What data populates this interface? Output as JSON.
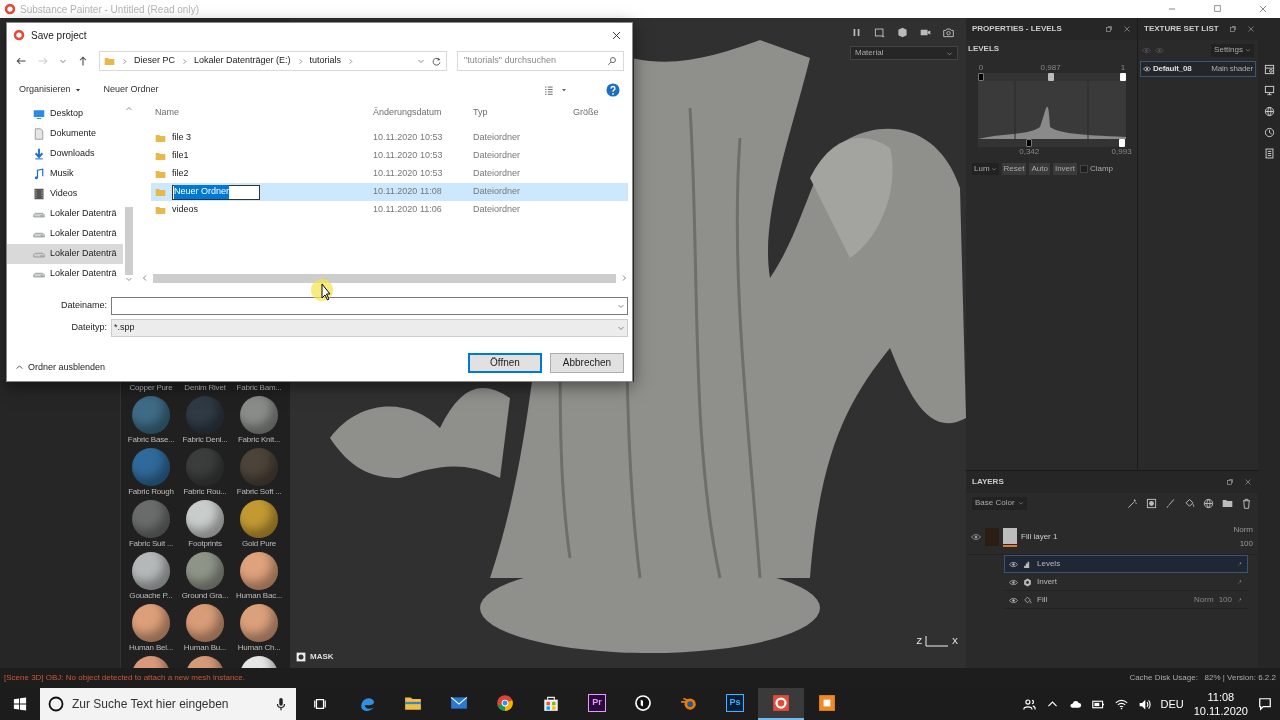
{
  "app_title": "Substance Painter - Untitled (Read only)",
  "dialog": {
    "title": "Save project",
    "breadcrumb": [
      "Dieser PC",
      "Lokaler Datenträger (E:)",
      "tutorials"
    ],
    "search": {
      "placeholder": "\"tutorials\" durchsuchen"
    },
    "toolbar": [
      {
        "label": "Organisieren",
        "menu": true
      },
      {
        "label": "Neuer Ordner",
        "menu": false
      }
    ],
    "sidebar": [
      {
        "kind": "desktop",
        "label": "Desktop",
        "selected": false
      },
      {
        "kind": "documents",
        "label": "Dokumente",
        "selected": false
      },
      {
        "kind": "downloads",
        "label": "Downloads",
        "selected": false
      },
      {
        "kind": "music",
        "label": "Musik",
        "selected": false
      },
      {
        "kind": "videos",
        "label": "Videos",
        "selected": false
      },
      {
        "kind": "drive",
        "label": "Lokaler Datenträ",
        "selected": false
      },
      {
        "kind": "drive",
        "label": "Lokaler Datenträ",
        "selected": false
      },
      {
        "kind": "drive",
        "label": "Lokaler Datenträ",
        "selected": true
      },
      {
        "kind": "drive",
        "label": "Lokaler Datenträ",
        "selected": false
      }
    ],
    "columns": [
      "Name",
      "Änderungsdatum",
      "Typ",
      "Größe"
    ],
    "files": [
      {
        "name": "file 3",
        "modified": "10.11.2020 10:53",
        "type": "Dateiordner",
        "selected": false,
        "editing": false
      },
      {
        "name": "file1",
        "modified": "10.11.2020 10:53",
        "type": "Dateiordner",
        "selected": false,
        "editing": false
      },
      {
        "name": "file2",
        "modified": "10.11.2020 10:53",
        "type": "Dateiordner",
        "selected": false,
        "editing": false
      },
      {
        "name": "Neuer Ordner",
        "modified": "10.11.2020 11:08",
        "type": "Dateiordner",
        "selected": true,
        "editing": true
      },
      {
        "name": "videos",
        "modified": "10.11.2020 11:06",
        "type": "Dateiordner",
        "selected": false,
        "editing": false
      }
    ],
    "fields": [
      {
        "kind": "combo",
        "label": "Dateiname:"
      },
      {
        "kind": "select",
        "label": "Dateityp:",
        "value": "*.spp"
      }
    ],
    "hide_folders": "Ordner ausblenden",
    "buttons": [
      {
        "label": "Öffnen",
        "default": true
      },
      {
        "label": "Abbrechen",
        "default": false
      }
    ]
  },
  "viewport": {
    "channel_dropdown": "Material",
    "mask_label": "MASK",
    "axes": [
      "Z",
      "X"
    ]
  },
  "properties": {
    "title": "PROPERTIES - LEVELS",
    "section": "LEVELS",
    "input_handles": [
      {
        "reading": "0",
        "level": 0
      },
      {
        "reading": "0,987",
        "level": 0.49
      },
      {
        "reading": "1",
        "level": 1
      }
    ],
    "output_handles": [
      {
        "reading": "0,342",
        "level": 0.34
      },
      {
        "reading": "0,993",
        "level": 0.99
      }
    ],
    "channel": "Lum",
    "buttons": [
      "Reset",
      "Auto",
      "Invert"
    ],
    "clamp": {
      "label": "Clamp",
      "checked": false
    }
  },
  "texture_set_list": {
    "title": "TEXTURE SET LIST",
    "settings": "Settings",
    "sets": [
      {
        "name": "Default_08",
        "shader": "Main shader",
        "selected": true,
        "visible": true
      }
    ]
  },
  "layers": {
    "title": "LAYERS",
    "channel": "Base Color",
    "items": [
      {
        "name": "Fill layer 1",
        "blend": "Norm",
        "opacity": "100",
        "visible": true,
        "selected": false,
        "children": [
          {
            "kind": "levels",
            "name": "Levels",
            "selected": true,
            "visible": true
          },
          {
            "kind": "invert",
            "name": "Invert",
            "selected": false,
            "visible": true
          },
          {
            "kind": "fill",
            "name": "Fill",
            "blend": "Norm",
            "opacity": "100",
            "selected": false,
            "visible": true
          }
        ]
      }
    ]
  },
  "shelf": {
    "header_labels": [
      "Copper Pure",
      "Denim Rivet",
      "Fabric Bam..."
    ],
    "materials": [
      {
        "label": "Fabric Base...",
        "color": "#3e6b86"
      },
      {
        "label": "Fabric Deni...",
        "color": "#2f3a44"
      },
      {
        "label": "Fabric Knit...",
        "color": "#8a8c8a"
      },
      {
        "label": "Fabric Rough",
        "color": "#2f6a9a"
      },
      {
        "label": "Fabric Rou...",
        "color": "#3b3c3c"
      },
      {
        "label": "Fabric Soft ...",
        "color": "#4c4339"
      },
      {
        "label": "Fabric Suit ...",
        "color": "#6a6c6c"
      },
      {
        "label": "Footprints",
        "color": "#c8cccb"
      },
      {
        "label": "Gold Pure",
        "color": "#c39a32"
      },
      {
        "label": "Gouache P...",
        "color": "#b4b8b8"
      },
      {
        "label": "Ground Gra...",
        "color": "#8e9488"
      },
      {
        "label": "Human Bac...",
        "color": "#dea27c"
      },
      {
        "label": "Human Bel...",
        "color": "#dc9f7a"
      },
      {
        "label": "Human Bu...",
        "color": "#d99c78"
      },
      {
        "label": "Human Ch...",
        "color": "#dba07c"
      }
    ],
    "partial_row": [
      {
        "color": "#d9997a"
      },
      {
        "color": "#d69a78"
      },
      {
        "color": "#e6e6e6"
      }
    ]
  },
  "status_bar": {
    "message": "[Scene 3D] OBJ: No object detected to attach a new mesh instance.",
    "info": "Cache Disk Usage:   82% | Version: 6.2.2"
  },
  "taskbar": {
    "search_placeholder": "Zur Suche Text hier eingeben",
    "apps": [
      {
        "kind": "edge",
        "active": false
      },
      {
        "kind": "explorer",
        "active": false
      },
      {
        "kind": "mail",
        "active": false
      },
      {
        "kind": "chrome",
        "active": false
      },
      {
        "kind": "store",
        "active": false
      },
      {
        "kind": "premiere",
        "label": "Pr",
        "active": false
      },
      {
        "kind": "unreal",
        "active": false
      },
      {
        "kind": "blender",
        "active": false
      },
      {
        "kind": "photoshop",
        "label": "Ps",
        "active": false
      },
      {
        "kind": "substance",
        "active": true
      },
      {
        "kind": "orange",
        "active": false
      }
    ],
    "language": "DEU",
    "time": "11:08",
    "date": "10.11.2020"
  }
}
